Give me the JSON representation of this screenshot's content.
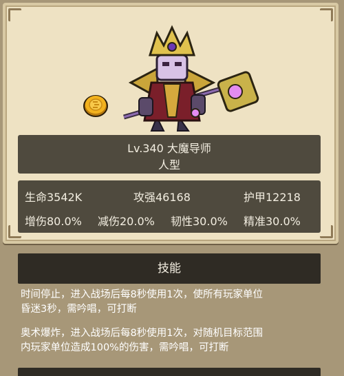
{
  "unit": {
    "level_name": "Lv.340 大魔导师",
    "race": "人型"
  },
  "stats": {
    "hp": "生命3542K",
    "attack": "攻强46168",
    "armor": "护甲12218",
    "damage_up": "增伤80.0%",
    "damage_down": "减伤20.0%",
    "toughness": "韧性30.0%",
    "accuracy": "精准30.0%"
  },
  "skills": {
    "header": "技能",
    "items": [
      {
        "line1": "时间停止，进入战场后每8秒使用1次，使所有玩家单位",
        "line2": "昏迷3秒，需吟唱，可打断"
      },
      {
        "line1": "奥术爆炸，进入战场后每8秒使用1次，对随机目标范围",
        "line2": "内玩家单位造成100%的伤害，需吟唱，可打断"
      }
    ]
  },
  "colors": {
    "panel_bg": "#eee2c3",
    "dark_bar": "#4f4a3e",
    "skill_bar": "#2f2b24",
    "page_bg": "#a79778"
  },
  "icons": [
    "coin-icon",
    "hero-portrait"
  ]
}
